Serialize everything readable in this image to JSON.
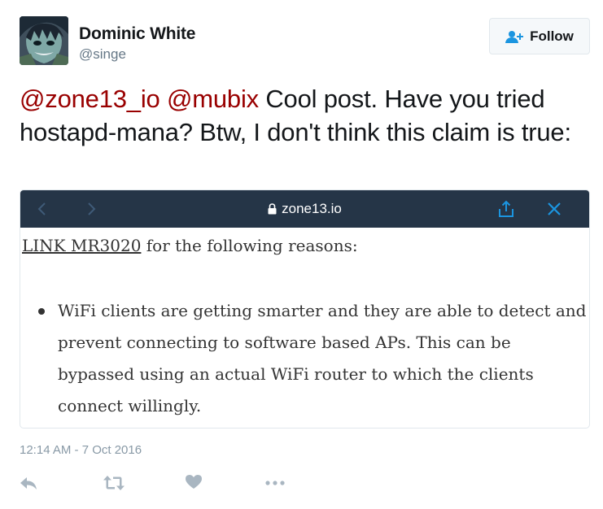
{
  "author": {
    "name": "Dominic White",
    "handle": "@singe"
  },
  "follow_button": {
    "label": "Follow",
    "icon": "add-user-icon"
  },
  "tweet": {
    "mention_1": "@zone13_io",
    "mention_2": "@mubix",
    "text": " Cool post. Have you tried hostapd-mana? Btw, I don't think this claim is true:"
  },
  "card": {
    "url": "zone13.io",
    "lock_icon": "lock-icon",
    "back_icon": "chevron-left-icon",
    "forward_icon": "chevron-right-icon",
    "share_icon": "share-icon",
    "close_icon": "close-icon",
    "link_text": "LINK MR3020",
    "para_rest": " for the following reasons:",
    "bullet_text": "WiFi clients are getting smarter and they are able to detect and prevent connecting to software based APs. This can be bypassed using an actual WiFi router to which the clients connect willingly."
  },
  "timestamp": "12:14 AM - 7 Oct 2016",
  "actions": {
    "reply_icon": "reply-icon",
    "retweet_icon": "retweet-icon",
    "like_icon": "heart-icon",
    "more_icon": "more-dots-icon"
  },
  "colors": {
    "mention": "#990000",
    "card_bar": "#253547",
    "card_icon": "#1b95e0",
    "muted": "#8899a6"
  }
}
